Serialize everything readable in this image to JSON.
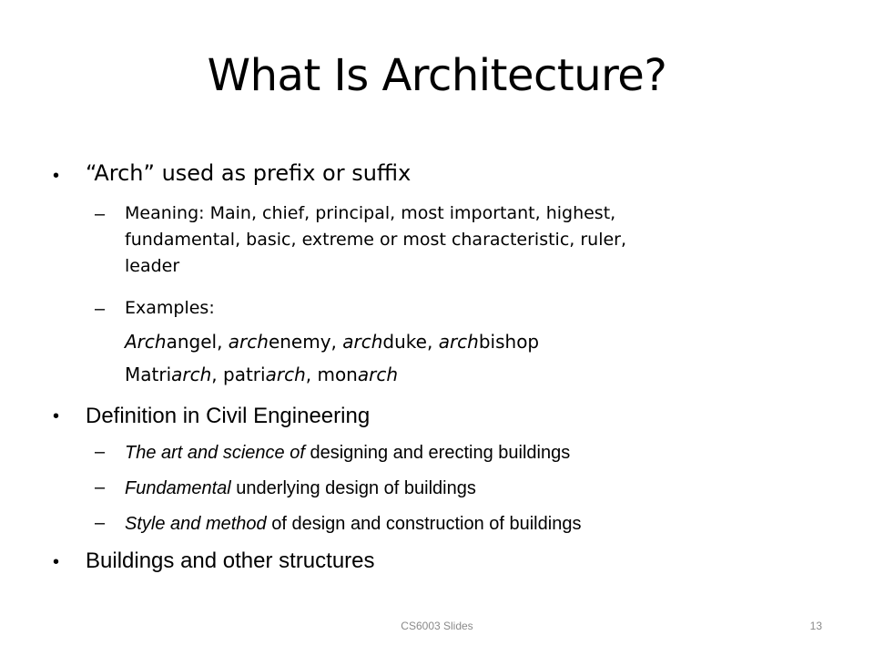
{
  "slide": {
    "title": "What Is Architecture?",
    "bullet_char": "•",
    "dash_char": "–",
    "b1": {
      "text": "“Arch” used as prefix or suffix",
      "meaning_lines": [
        "Meaning: Main, chief, principal, most important, highest,",
        "fundamental, basic, extreme or most characteristic, ruler,",
        "leader"
      ],
      "examples_label": "Examples:",
      "ex1": [
        "Arch",
        "angel, ",
        "arch",
        "enemy, ",
        "arch",
        "duke, ",
        "arch",
        "bishop"
      ],
      "ex2": [
        "Matri",
        "arch",
        ", patri",
        "arch",
        ", mon",
        "arch"
      ]
    },
    "b2": {
      "text": "Definition in Civil Engineering",
      "s1": [
        "The art and science of",
        " designing and erecting buildings"
      ],
      "s2": [
        "Fundamental",
        " underlying design of buildings"
      ],
      "s3": [
        "Style and method",
        " of design and construction of buildings"
      ]
    },
    "b3": {
      "text": "Buildings and other structures"
    },
    "footer": {
      "label": "CS6003 Slides",
      "page": "13"
    }
  }
}
